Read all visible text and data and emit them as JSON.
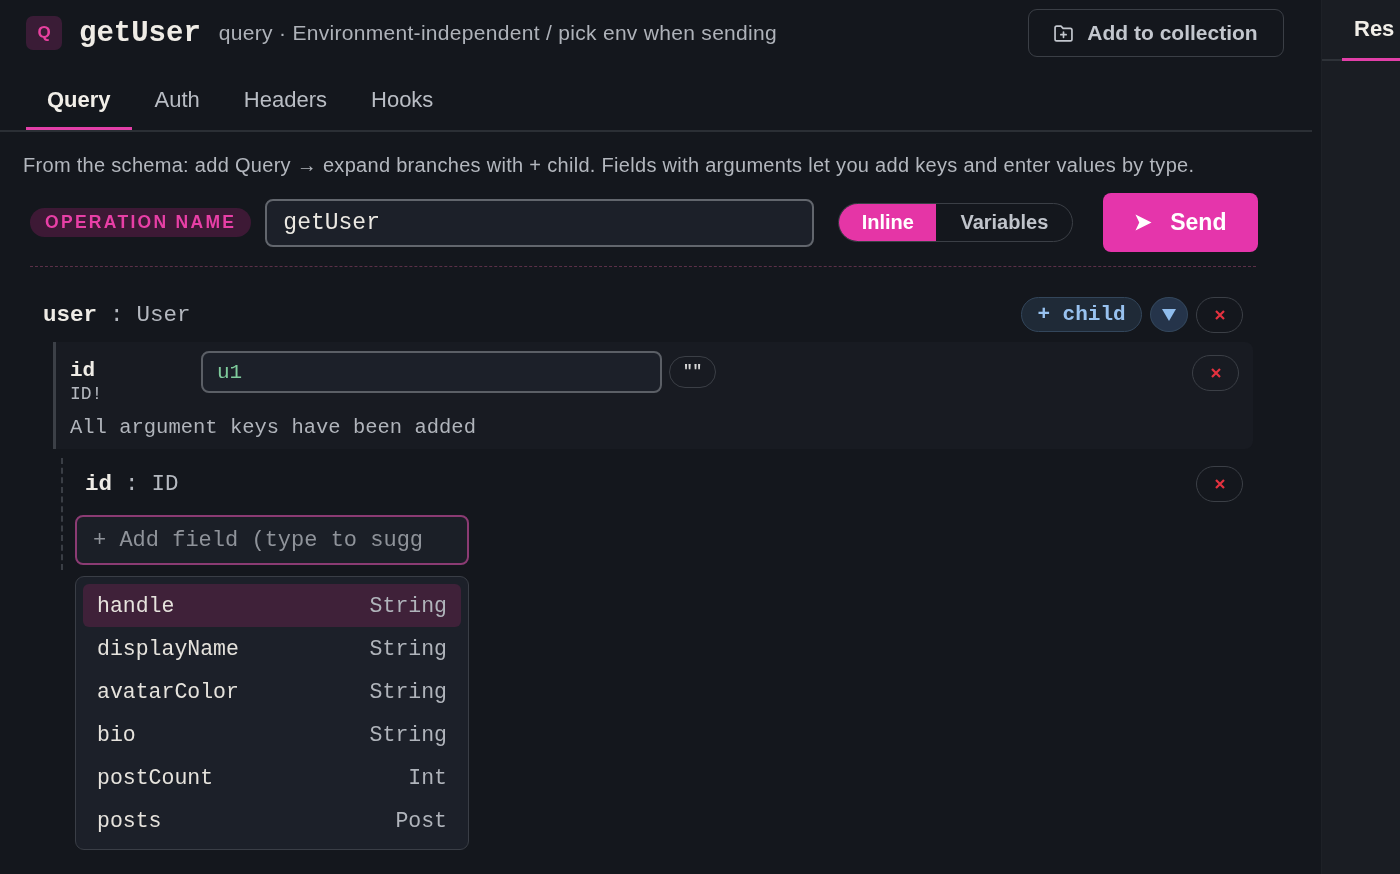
{
  "request_header": {
    "badge": "Q",
    "title": "getUser",
    "subtitle": "query · Environment-independent / pick env when sending",
    "collection_button": "Add to collection"
  },
  "tabs": [
    {
      "label": "Query",
      "selected": true
    },
    {
      "label": "Auth",
      "selected": false
    },
    {
      "label": "Headers",
      "selected": false
    },
    {
      "label": "Hooks",
      "selected": false
    }
  ],
  "hint": "From the schema: add Query → expand branches with + child. Fields with arguments let you add keys and enter values by type.",
  "operation": {
    "label": "OPERATION NAME",
    "value": "getUser",
    "modes": [
      {
        "label": "Inline",
        "selected": true
      },
      {
        "label": "Variables",
        "selected": false
      }
    ],
    "send_button": "Send"
  },
  "query_tree": [
    {
      "name": "user",
      "separator": ":",
      "type": "User",
      "expanded": true,
      "child_button": "+ child",
      "arguments": [
        {
          "name": "id",
          "type": "ID!",
          "value": "u1",
          "quote_button": "\"\""
        }
      ],
      "arguments_note": "All argument keys have been added",
      "children": [
        {
          "name": "id",
          "separator": ":",
          "type": "ID"
        }
      ],
      "add_field": {
        "placeholder": "+ Add field (type to sugg"
      },
      "suggestions": [
        {
          "name": "handle",
          "type": "String",
          "selected": true
        },
        {
          "name": "displayName",
          "type": "String",
          "selected": false
        },
        {
          "name": "avatarColor",
          "type": "String",
          "selected": false
        },
        {
          "name": "bio",
          "type": "String",
          "selected": false
        },
        {
          "name": "postCount",
          "type": "Int",
          "selected": false
        },
        {
          "name": "posts",
          "type": "Post",
          "selected": false
        }
      ]
    }
  ],
  "right_panel": {
    "tabs": [
      {
        "label": "Res",
        "selected": true
      }
    ]
  }
}
